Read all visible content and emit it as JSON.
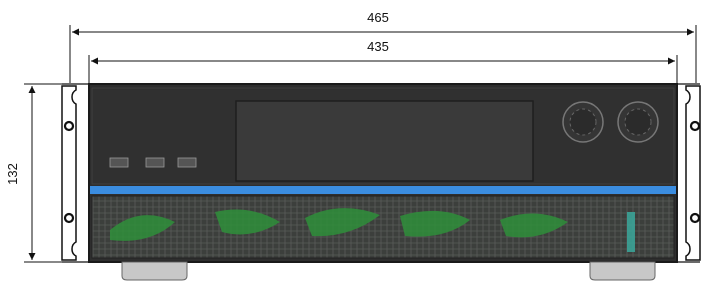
{
  "dimensions": {
    "overall_width": "465",
    "panel_width": "435",
    "height": "132"
  },
  "front_buttons": [
    "",
    "",
    ""
  ],
  "knobs": 2,
  "colors": {
    "line": "#111111",
    "panel_top": "#2e2e2e",
    "panel_border": "#1a1a1a",
    "display": "#3a3a3a",
    "accent_strip": "#3b8de0",
    "grille_bg": "#3c3f3c",
    "grille_green": "#2f8f3a",
    "grille_teal": "#3aa89c",
    "feet": "#c8c8c8"
  }
}
